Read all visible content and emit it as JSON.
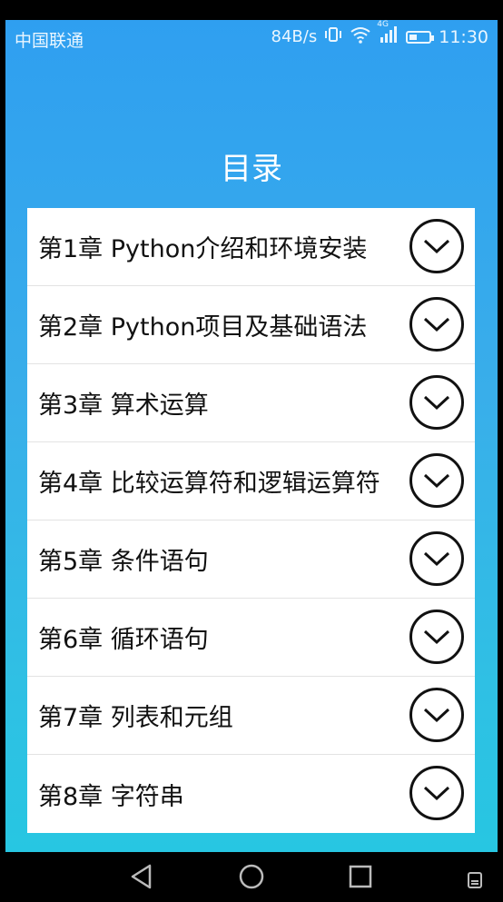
{
  "statusbar": {
    "carrier": "中国联通",
    "net_speed": "84B/s",
    "network_type": "4G",
    "time": "11:30",
    "icons": [
      "vibrate-icon",
      "wifi-icon",
      "signal-icon",
      "battery-icon"
    ]
  },
  "page": {
    "title": "目录"
  },
  "chapters": [
    {
      "label": "第1章 Python介绍和环境安装"
    },
    {
      "label": "第2章 Python项目及基础语法"
    },
    {
      "label": "第3章 算术运算"
    },
    {
      "label": "第4章 比较运算符和逻辑运算符"
    },
    {
      "label": "第5章 条件语句"
    },
    {
      "label": "第6章 循环语句"
    },
    {
      "label": "第7章 列表和元组"
    },
    {
      "label": "第8章 字符串"
    }
  ],
  "navbar": {
    "icons": [
      "back-icon",
      "home-icon",
      "recents-icon",
      "notification-icon"
    ]
  },
  "colors": {
    "background_top": "#2f9ff0",
    "background_bottom": "#27c6e2",
    "card": "#ffffff",
    "text": "#111111"
  }
}
